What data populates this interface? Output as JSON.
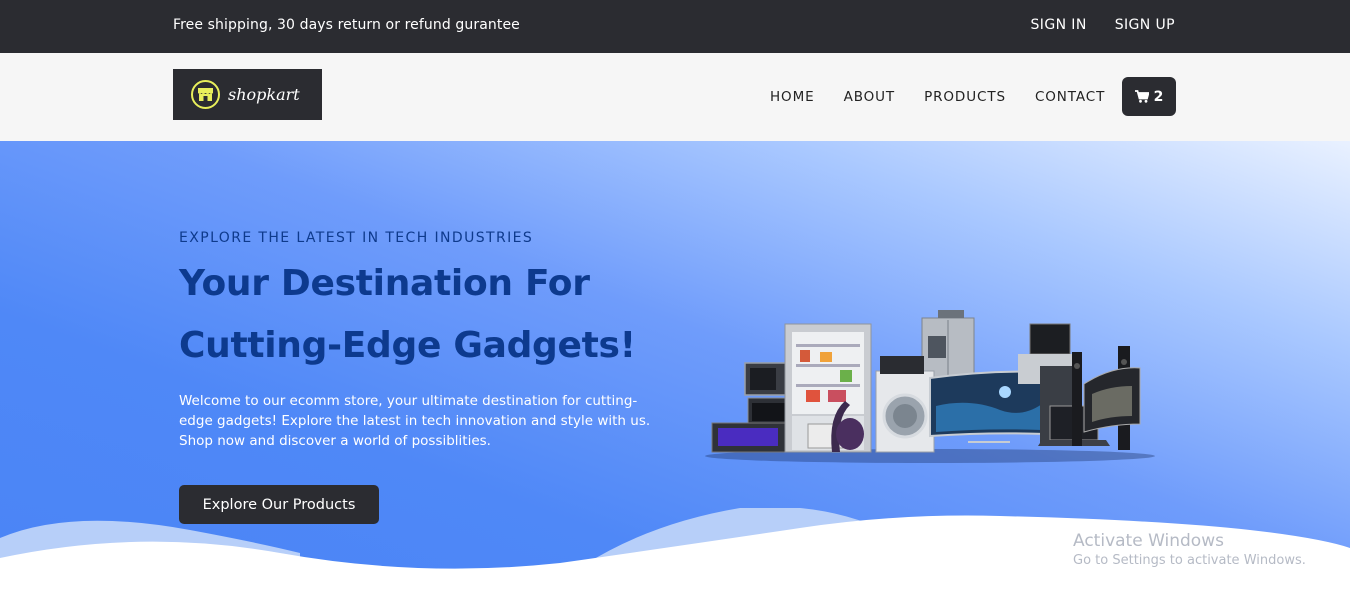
{
  "topbar": {
    "notice": "Free shipping, 30 days return or refund gurantee",
    "sign_in": "SIGN IN",
    "sign_up": "SIGN UP"
  },
  "header": {
    "logo_text": "shopkart",
    "nav": [
      "HOME",
      "ABOUT",
      "PRODUCTS",
      "CONTACT"
    ],
    "cart_count": "2"
  },
  "hero": {
    "kicker": "EXPLORE THE LATEST IN TECH INDUSTRIES",
    "headline_line1": "Your Destination For",
    "headline_line2": "Cutting-Edge Gadgets!",
    "description": "Welcome to our ecomm store, your ultimate destination for cutting-edge gadgets! Explore the latest in tech innovation and style with us. Shop now and discover a world of possiblities.",
    "cta_label": "Explore Our Products"
  },
  "watermark": {
    "line1": "Activate Windows",
    "line2": "Go to Settings to activate Windows."
  },
  "colors": {
    "dark": "#2b2c31",
    "accent_yellow": "#e8ef5b",
    "hero_blue": "#4a84f6",
    "heading_blue": "#0d3a8e"
  }
}
